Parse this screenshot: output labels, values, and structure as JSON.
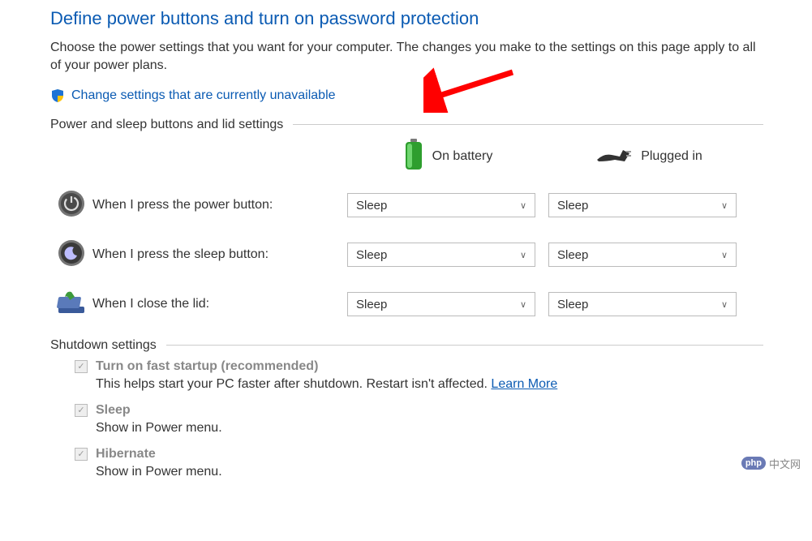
{
  "page": {
    "title": "Define power buttons and turn on password protection",
    "description": "Choose the power settings that you want for your computer. The changes you make to the settings on this page apply to all of your power plans.",
    "change_link": "Change settings that are currently unavailable"
  },
  "sections": {
    "power_sleep": {
      "header": "Power and sleep buttons and lid settings",
      "columns": {
        "battery": "On battery",
        "plugged": "Plugged in"
      },
      "rows": [
        {
          "icon": "power-button-icon",
          "label": "When I press the power button:",
          "battery": "Sleep",
          "plugged": "Sleep"
        },
        {
          "icon": "sleep-button-icon",
          "label": "When I press the sleep button:",
          "battery": "Sleep",
          "plugged": "Sleep"
        },
        {
          "icon": "lid-close-icon",
          "label": "When I close the lid:",
          "battery": "Sleep",
          "plugged": "Sleep"
        }
      ]
    },
    "shutdown": {
      "header": "Shutdown settings",
      "items": [
        {
          "title": "Turn on fast startup (recommended)",
          "desc": "This helps start your PC faster after shutdown. Restart isn't affected. ",
          "link": "Learn More",
          "checked": true
        },
        {
          "title": "Sleep",
          "desc": "Show in Power menu.",
          "checked": true
        },
        {
          "title": "Hibernate",
          "desc": "Show in Power menu.",
          "checked": true
        }
      ]
    }
  },
  "watermark": {
    "badge": "php",
    "text": "中文网"
  }
}
